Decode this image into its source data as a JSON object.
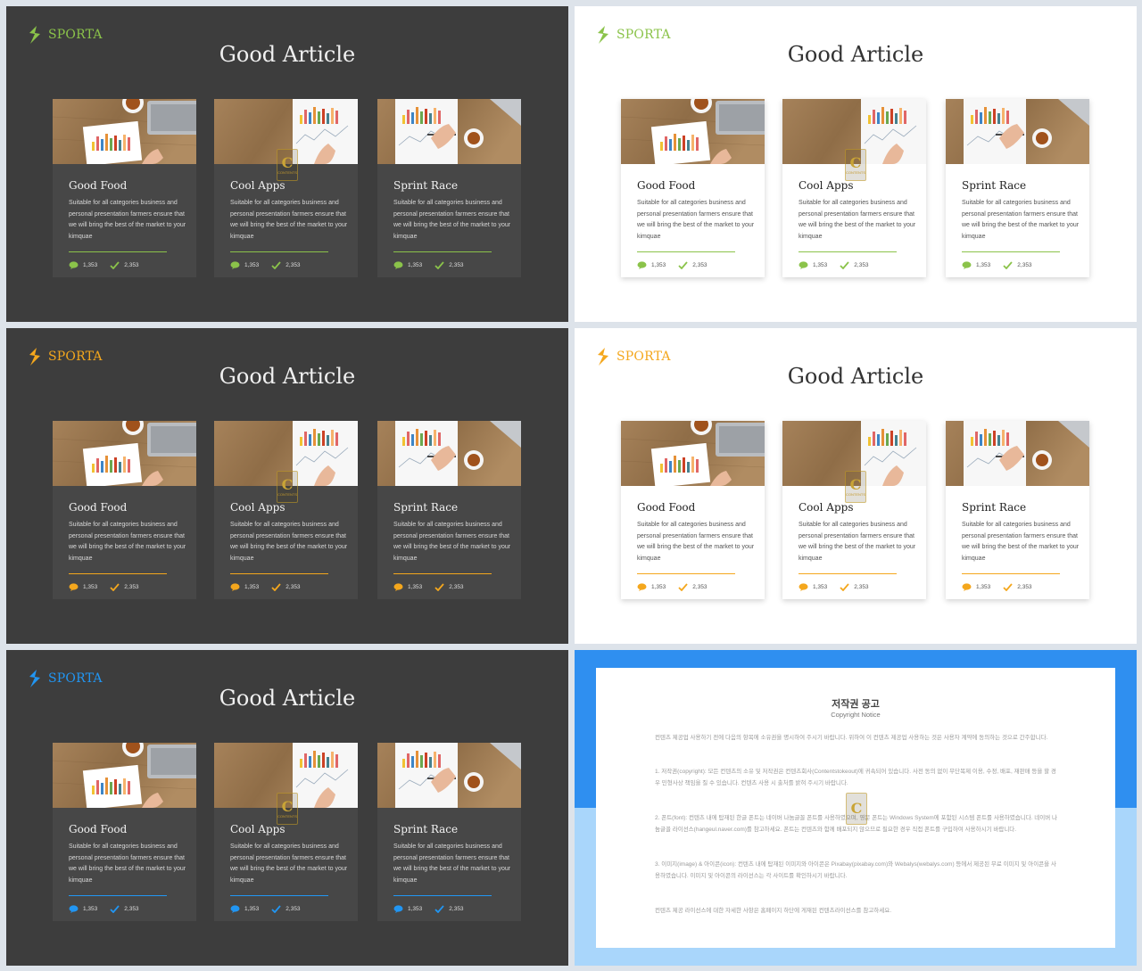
{
  "brand": "SPORTA",
  "slide_title": "Good Article",
  "cards": [
    {
      "title": "Good Food",
      "desc": "Suitable for all categories business and personal presentation farmers ensure that we will bring the best of the market to your kimquae",
      "comments": "1,353",
      "likes": "2,353"
    },
    {
      "title": "Cool Apps",
      "desc": "Suitable for all categories business and personal presentation farmers ensure that we will bring the best of the market to your kimquae",
      "comments": "1,353",
      "likes": "2,353"
    },
    {
      "title": "Sprint Race",
      "desc": "Suitable for all categories business and personal presentation farmers ensure that we will bring the best of the market to your kimquae",
      "comments": "1,353",
      "likes": "2,353"
    }
  ],
  "watermark": {
    "letter": "C",
    "text": "CONTENTS"
  },
  "accents": {
    "green": "#8bc34a",
    "orange": "#f4a71d",
    "blue": "#2196f3"
  },
  "notice": {
    "title": "저작권 공고",
    "subtitle": "Copyright Notice",
    "p0": "컨텐츠 제공업 사용하기 전에 다음의 항목에 소유권을 명시하여 주시기 바랍니다. 위하여 이 컨텐츠 제공업 사용하는 것은 사용자 계약에 동의하는 것으로 간주합니다.",
    "p1": "1. 저작권(copyright): 모든 컨텐츠의 소유 및 저작권은 컨텐츠회사(Contentstokeout)에 귀속되어 있습니다. 사전 동의 없이 무단복제 이용, 수정, 배포, 재판매 등을 할 경우 민형사상 책임을 질 수 있습니다. 컨텐츠 사용 시 출처를 밝혀 주시기 바랍니다.",
    "p2": "2. 폰트(font): 컨텐츠 내에 탑재된 한글 폰트는 네이버 나눔글꼴 폰트를 사용하였으며, 영문 폰트는 Windows System에 포함된 시스템 폰트를 사용하였습니다. 네이버 나눔글꼴 라이선스(hangeul.naver.com)를 참고하세요. 폰트는 컨텐츠와 함께 배포되지 않으므로 필요한 경우 직접 폰트를 구입하여 사용하시기 바랍니다.",
    "p3": "3. 이미지(image) & 아이콘(icon): 컨텐츠 내에 탑재된 이미지와 아이콘은 Pixabay(pixabay.com)와 Webalys(webalys.com) 등에서 제공된 무료 이미지 및 아이콘을 사용하였습니다. 이미지 및 아이콘의 라이선스는 각 사이트를 확인하시기 바랍니다.",
    "p4": "컨텐츠 제공 라이선스에 대한 자세한 사항은 홈페이지 하단에 게재된 컨텐츠라이선스를 참고하세요."
  }
}
